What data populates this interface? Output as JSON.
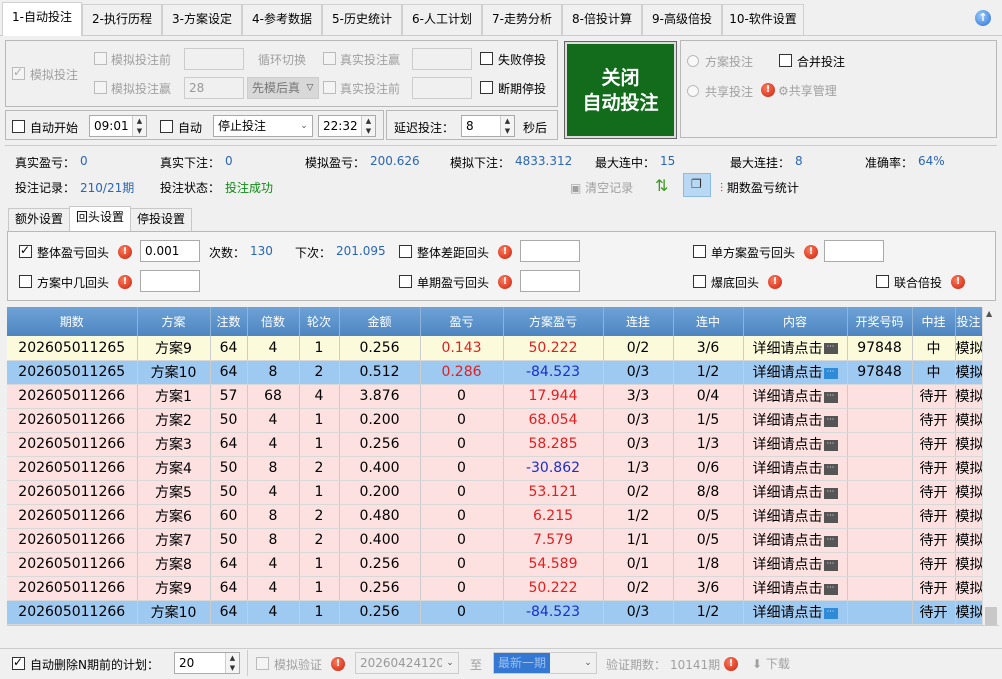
{
  "tabs": [
    "1-自动投注",
    "2-执行历程",
    "3-方案设定",
    "4-参考数据",
    "5-历史统计",
    "6-人工计划",
    "7-走势分析",
    "8-倍投计算",
    "9-高级倍投",
    "10-软件设置"
  ],
  "colors": {
    "accent_green": "#126c1c",
    "header_blue": "#5a8ec8",
    "value_blue": "#2a66b5",
    "win_red": "#e02020",
    "loss_blue": "#1a2fc8"
  },
  "mode": {
    "sim_bet_label": "模拟投注",
    "sim_before_label": "模拟投注前",
    "sim_before_value": "",
    "cycle_label": "循环切换",
    "real_win_label": "真实投注赢",
    "real_win_value": "",
    "sim_win_label": "模拟投注赢",
    "sim_win_value": "28",
    "order_select": "先模后真",
    "real_before_label": "真实投注前",
    "real_before_value": "",
    "fail_stop_label": "失败停投",
    "break_stop_label": "断期停投"
  },
  "big_button": {
    "line1": "关闭",
    "line2": "自动投注"
  },
  "share": {
    "plan_bet": "方案投注",
    "merge_bet": "合并投注",
    "share_bet": "共享投注",
    "share_manage": "共享管理"
  },
  "schedule": {
    "auto_start_label": "自动开始",
    "start_time": "09:01",
    "auto_label": "自动",
    "action_select": "停止投注",
    "stop_time": "22:32",
    "delay_label": "延迟投注：",
    "delay_value": "8",
    "delay_unit": "秒后"
  },
  "stats": {
    "real_pl_label": "真实盈亏：",
    "real_pl": "0",
    "real_bet_label": "真实下注：",
    "real_bet": "0",
    "sim_pl_label": "模拟盈亏：",
    "sim_pl": "200.626",
    "sim_bet_label": "模拟下注：",
    "sim_bet": "4833.312",
    "max_win_label": "最大连中：",
    "max_win": "15",
    "max_loss_label": "最大连挂：",
    "max_loss": "8",
    "accuracy_label": "准确率：",
    "accuracy": "64%",
    "record_label": "投注记录：",
    "record": "210/21期",
    "status_label": "投注状态：",
    "status": "投注成功",
    "clear_label": "清空记录",
    "period_stats_label": "期数盈亏统计"
  },
  "subtabs": [
    "额外设置",
    "回头设置",
    "停投设置"
  ],
  "backset": {
    "whole_pl_label": "整体盈亏回头",
    "whole_pl_value": "0.001",
    "count_label": "次数：",
    "count": "130",
    "next_label": "下次：",
    "next": "201.095",
    "whole_gap_label": "整体差距回头",
    "whole_gap_value": "",
    "single_plan_label": "单方案盈亏回头",
    "single_plan_value": "",
    "plan_nth_label": "方案中几回头",
    "plan_nth_value": "",
    "single_period_label": "单期盈亏回头",
    "single_period_value": "",
    "bottom_label": "爆底回头",
    "joint_label": "联合倍投"
  },
  "table": {
    "headers": [
      "期数",
      "方案",
      "注数",
      "倍数",
      "轮次",
      "金额",
      "盈亏",
      "方案盈亏",
      "连挂",
      "连中",
      "内容",
      "开奖号码",
      "中挂",
      "投注"
    ],
    "detail_text": "详细请点击",
    "rows": [
      {
        "style": "c-y",
        "period": "202605011265",
        "plan": "方案9",
        "notes": "64",
        "mult": "4",
        "round": "1",
        "amount": "0.256",
        "pl": "0.143",
        "pl_c": "red",
        "plan_pl": "50.222",
        "plan_pl_c": "red",
        "losses": "0/2",
        "wins": "3/6",
        "draw": "97848",
        "hit": "中",
        "bet": "模拟"
      },
      {
        "style": "c-b",
        "period": "202605011265",
        "plan": "方案10",
        "notes": "64",
        "mult": "8",
        "round": "2",
        "amount": "0.512",
        "pl": "0.286",
        "pl_c": "red",
        "plan_pl": "-84.523",
        "plan_pl_c": "blu",
        "losses": "0/3",
        "wins": "1/2",
        "draw": "97848",
        "hit": "中",
        "bet": "模拟"
      },
      {
        "style": "c-p",
        "period": "202605011266",
        "plan": "方案1",
        "notes": "57",
        "mult": "68",
        "round": "4",
        "amount": "3.876",
        "pl": "0",
        "pl_c": "",
        "plan_pl": "17.944",
        "plan_pl_c": "red",
        "losses": "3/3",
        "wins": "0/4",
        "draw": "",
        "hit": "待开",
        "bet": "模拟"
      },
      {
        "style": "c-p",
        "period": "202605011266",
        "plan": "方案2",
        "notes": "50",
        "mult": "4",
        "round": "1",
        "amount": "0.200",
        "pl": "0",
        "pl_c": "",
        "plan_pl": "68.054",
        "plan_pl_c": "red",
        "losses": "0/3",
        "wins": "1/5",
        "draw": "",
        "hit": "待开",
        "bet": "模拟"
      },
      {
        "style": "c-p",
        "period": "202605011266",
        "plan": "方案3",
        "notes": "64",
        "mult": "4",
        "round": "1",
        "amount": "0.256",
        "pl": "0",
        "pl_c": "",
        "plan_pl": "58.285",
        "plan_pl_c": "red",
        "losses": "0/3",
        "wins": "1/3",
        "draw": "",
        "hit": "待开",
        "bet": "模拟"
      },
      {
        "style": "c-p",
        "period": "202605011266",
        "plan": "方案4",
        "notes": "50",
        "mult": "8",
        "round": "2",
        "amount": "0.400",
        "pl": "0",
        "pl_c": "",
        "plan_pl": "-30.862",
        "plan_pl_c": "blu",
        "losses": "1/3",
        "wins": "0/6",
        "draw": "",
        "hit": "待开",
        "bet": "模拟"
      },
      {
        "style": "c-p",
        "period": "202605011266",
        "plan": "方案5",
        "notes": "50",
        "mult": "4",
        "round": "1",
        "amount": "0.200",
        "pl": "0",
        "pl_c": "",
        "plan_pl": "53.121",
        "plan_pl_c": "red",
        "losses": "0/2",
        "wins": "8/8",
        "draw": "",
        "hit": "待开",
        "bet": "模拟"
      },
      {
        "style": "c-p",
        "period": "202605011266",
        "plan": "方案6",
        "notes": "60",
        "mult": "8",
        "round": "2",
        "amount": "0.480",
        "pl": "0",
        "pl_c": "",
        "plan_pl": "6.215",
        "plan_pl_c": "red",
        "losses": "1/2",
        "wins": "0/5",
        "draw": "",
        "hit": "待开",
        "bet": "模拟"
      },
      {
        "style": "c-p",
        "period": "202605011266",
        "plan": "方案7",
        "notes": "50",
        "mult": "8",
        "round": "2",
        "amount": "0.400",
        "pl": "0",
        "pl_c": "",
        "plan_pl": "7.579",
        "plan_pl_c": "red",
        "losses": "1/1",
        "wins": "0/5",
        "draw": "",
        "hit": "待开",
        "bet": "模拟"
      },
      {
        "style": "c-p",
        "period": "202605011266",
        "plan": "方案8",
        "notes": "64",
        "mult": "4",
        "round": "1",
        "amount": "0.256",
        "pl": "0",
        "pl_c": "",
        "plan_pl": "54.589",
        "plan_pl_c": "red",
        "losses": "0/1",
        "wins": "1/8",
        "draw": "",
        "hit": "待开",
        "bet": "模拟"
      },
      {
        "style": "c-p",
        "period": "202605011266",
        "plan": "方案9",
        "notes": "64",
        "mult": "4",
        "round": "1",
        "amount": "0.256",
        "pl": "0",
        "pl_c": "",
        "plan_pl": "50.222",
        "plan_pl_c": "red",
        "losses": "0/2",
        "wins": "3/6",
        "draw": "",
        "hit": "待开",
        "bet": "模拟"
      },
      {
        "style": "c-b",
        "period": "202605011266",
        "plan": "方案10",
        "notes": "64",
        "mult": "4",
        "round": "1",
        "amount": "0.256",
        "pl": "0",
        "pl_c": "",
        "plan_pl": "-84.523",
        "plan_pl_c": "blu",
        "losses": "0/3",
        "wins": "1/2",
        "draw": "",
        "hit": "待开",
        "bet": "模拟"
      }
    ]
  },
  "footer": {
    "auto_delete_label": "自动删除N期前的计划：",
    "auto_delete_value": "20",
    "sim_verify_label": "模拟验证",
    "from_date": "20260424120",
    "to_label": "至",
    "to_value": "最新一期",
    "verify_count_label": "验证期数：",
    "verify_count": "10141期",
    "download_label": "下载"
  }
}
